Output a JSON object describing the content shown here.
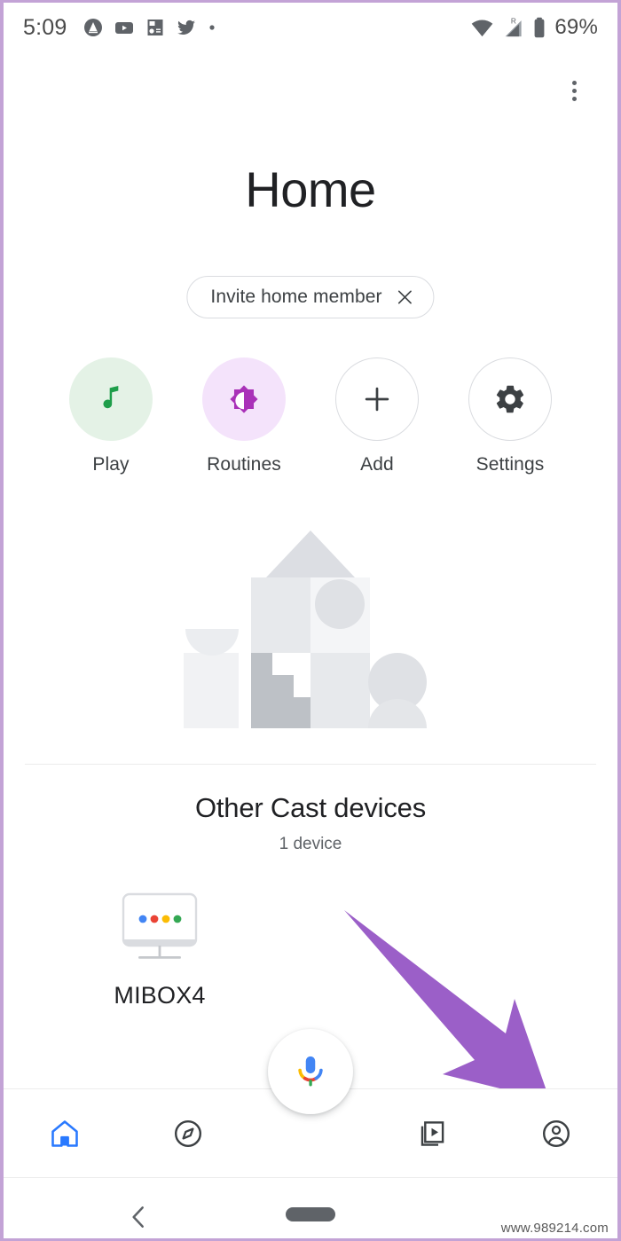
{
  "status_bar": {
    "time": "5:09",
    "battery_percent": "69%",
    "notification_icons": [
      "app-badge-icon",
      "youtube-icon",
      "media-file-icon",
      "twitter-icon",
      "more-notifications-dot"
    ],
    "signal_icons": [
      "wifi-icon",
      "cellular-roaming-icon",
      "battery-icon"
    ],
    "roaming_label": "R"
  },
  "app_bar": {
    "overflow_label": "More options"
  },
  "header": {
    "title": "Home"
  },
  "invite_chip": {
    "label": "Invite home member",
    "close_icon": "close-icon"
  },
  "actions": [
    {
      "label": "Play",
      "icon": "music-note-icon",
      "bg": "#e4f2e6",
      "fg": "#1e9e4a",
      "outlined": false
    },
    {
      "label": "Routines",
      "icon": "brightness-icon",
      "bg": "#f4e3fb",
      "fg": "#a931b8",
      "outlined": false
    },
    {
      "label": "Add",
      "icon": "plus-icon",
      "bg": "#ffffff",
      "fg": "#3c4043",
      "outlined": true
    },
    {
      "label": "Settings",
      "icon": "gear-icon",
      "bg": "#ffffff",
      "fg": "#3c4043",
      "outlined": true
    }
  ],
  "illustration": {
    "name": "empty-home-illustration"
  },
  "cast_section": {
    "title": "Other Cast devices",
    "subtitle": "1 device",
    "devices": [
      {
        "name": "MIBOX4",
        "icon": "cast-tv-icon",
        "dot_colors": [
          "#4285f4",
          "#ea4335",
          "#fbbc04",
          "#34a853"
        ]
      }
    ]
  },
  "assistant_fab": {
    "icon": "google-assistant-mic-icon",
    "colors": {
      "blue": "#4285f4",
      "red": "#ea4335",
      "yellow": "#fbbc04",
      "green": "#34a853"
    }
  },
  "bottom_nav": {
    "active_color": "#2979ff",
    "inactive_color": "#3c4043",
    "items": [
      {
        "icon": "home-icon",
        "name": "nav-home",
        "active": true
      },
      {
        "icon": "compass-icon",
        "name": "nav-explore",
        "active": false
      },
      {
        "icon": "media-icon",
        "name": "nav-media",
        "active": false
      },
      {
        "icon": "account-icon",
        "name": "nav-account",
        "active": false
      }
    ]
  },
  "annotation": {
    "type": "arrow",
    "color": "#9b5fc8",
    "points_to": "nav-account"
  },
  "system_nav": {
    "back_icon": "chevron-left-icon",
    "home_pill": "home-pill-indicator"
  },
  "watermark": {
    "text": "www.989214.com"
  }
}
